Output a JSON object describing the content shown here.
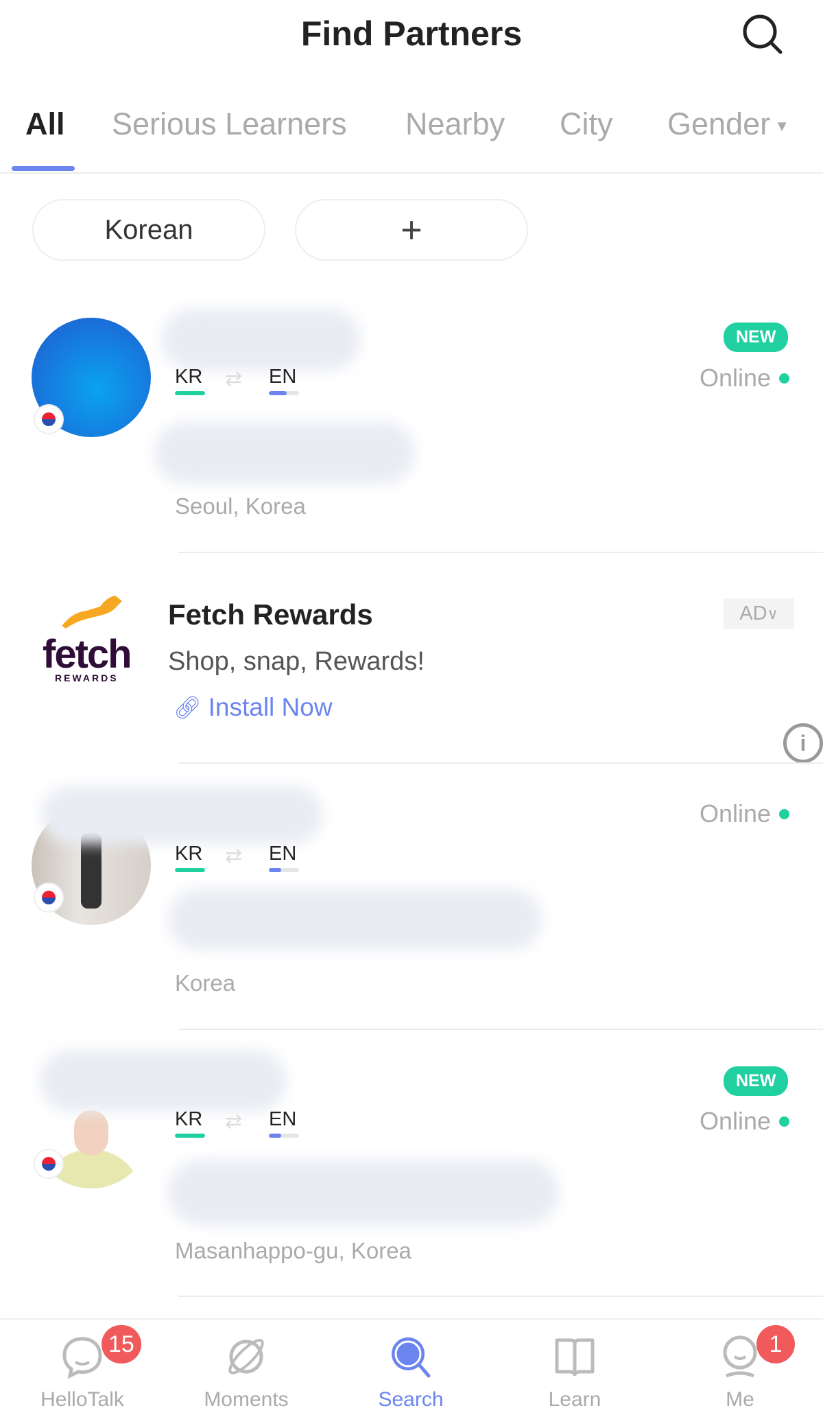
{
  "header": {
    "title": "Find Partners",
    "search_icon": "search-icon"
  },
  "tabs": [
    {
      "label": "All",
      "active": true
    },
    {
      "label": "Serious Learners"
    },
    {
      "label": "Nearby"
    },
    {
      "label": "City"
    },
    {
      "label": "Gender",
      "dropdown": true
    }
  ],
  "filters": {
    "language_chip": "Korean",
    "add_chip": "+"
  },
  "partners": [
    {
      "native": "KR",
      "learning": "EN",
      "native_level": 1.0,
      "learning_level": 0.6,
      "location": "Seoul, Korea",
      "status": "Online",
      "new_badge": "NEW",
      "flag": "south-korea"
    },
    {
      "native": "KR",
      "learning": "EN",
      "native_level": 1.0,
      "learning_level": 0.4,
      "location": "Korea",
      "status": "Online",
      "flag": "south-korea"
    },
    {
      "native": "KR",
      "learning": "EN",
      "native_level": 1.0,
      "learning_level": 0.4,
      "location": "Masanhappo-gu, Korea",
      "status": "Online",
      "new_badge": "NEW",
      "flag": "south-korea"
    }
  ],
  "ad": {
    "logo_text": "fetch",
    "logo_sub": "REWARDS",
    "title": "Fetch Rewards",
    "subtitle": "Shop, snap, Rewards!",
    "cta": "Install Now",
    "badge": "AD"
  },
  "colors": {
    "accent": "#6b84ee",
    "online": "#21d0a0",
    "badge": "#f05a5a",
    "native_bar": "#21d0a0",
    "learning_bar": "#6b84ee"
  },
  "nav": [
    {
      "label": "HelloTalk",
      "badge": "15"
    },
    {
      "label": "Moments"
    },
    {
      "label": "Search",
      "active": true
    },
    {
      "label": "Learn"
    },
    {
      "label": "Me",
      "badge": "1"
    }
  ]
}
